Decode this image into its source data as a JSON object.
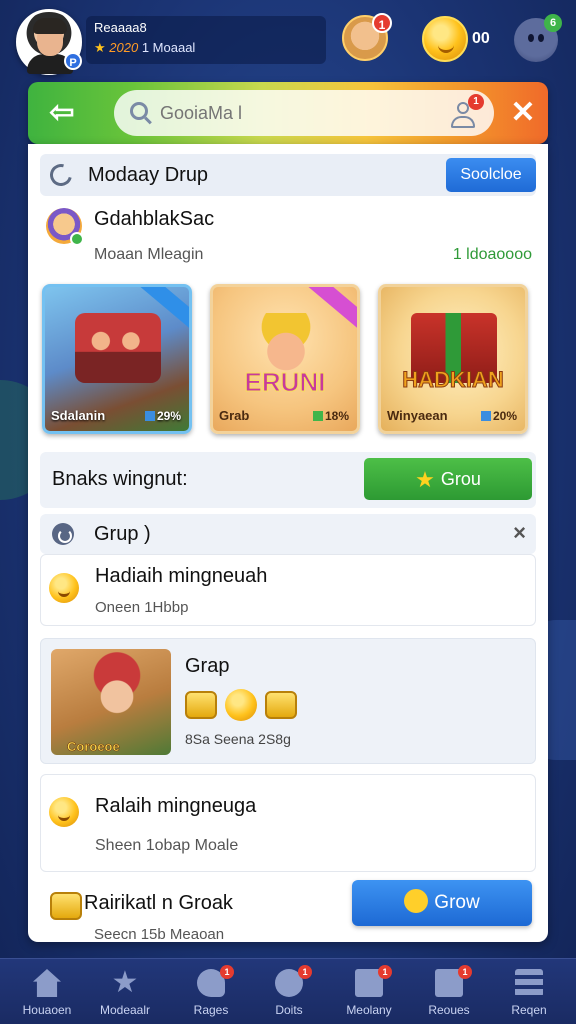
{
  "header": {
    "username": "Reaaaa8",
    "status_rank": "★",
    "status_value": "2020",
    "status_text": "1 Moaaal",
    "avatar_badge": "P",
    "friend_badge": "1",
    "coin_count": "00",
    "menu_badge": "6"
  },
  "search": {
    "value": "GooiaMa l",
    "placeholder": "GooiaMa l",
    "user_badge": "1"
  },
  "group_header": {
    "title": "Modaay Drup",
    "select_label": "Soolcloe"
  },
  "player": {
    "name": "GdahblakSac",
    "subtitle": "Moaan Mleagin",
    "meta": "1 ldoaoooo"
  },
  "cards": [
    {
      "caption": "Sdalanin",
      "percent": "29%",
      "title": ""
    },
    {
      "caption": "Grab",
      "percent": "18%",
      "title": "ERUNI"
    },
    {
      "caption": "Winyaean",
      "percent": "20%",
      "title": "HADKIAN"
    }
  ],
  "winners": {
    "title": "Bnaks wingnut:",
    "button_label": "Grou"
  },
  "grup": {
    "label": "Grup )",
    "close": "×"
  },
  "reward1": {
    "title": "Hadiaih mingneuah",
    "subtitle": "Oneen 1Hbbp"
  },
  "grap_card": {
    "image_caption": "Coroeoe",
    "title": "Grap",
    "subtitle": "8Sa Seena 2S8g"
  },
  "reward2": {
    "title": "Ralaih mingneuga",
    "subtitle": "Sheen 1obap Moale"
  },
  "last_item": {
    "title": "Rairikatl n Groak",
    "subtitle": "Seecn 15b   Meaoan",
    "button_label": "Grow"
  },
  "bottom_nav": [
    {
      "label": "Houaoen",
      "icon": "home-icon",
      "badge": ""
    },
    {
      "label": "Modeaalr",
      "icon": "star-icon",
      "badge": ""
    },
    {
      "label": "Rages",
      "icon": "chat-icon",
      "badge": "1"
    },
    {
      "label": "Doits",
      "icon": "dots-icon",
      "badge": "1"
    },
    {
      "label": "Meolany",
      "icon": "box-icon",
      "badge": "1"
    },
    {
      "label": "Reoues",
      "icon": "gift-icon",
      "badge": "1"
    },
    {
      "label": "Reqen",
      "icon": "menu-icon",
      "badge": ""
    }
  ],
  "colors": {
    "accent_green": "#3fb33f",
    "accent_blue": "#1f6bd6",
    "accent_orange": "#f06a2a",
    "background": "#1b3474"
  }
}
